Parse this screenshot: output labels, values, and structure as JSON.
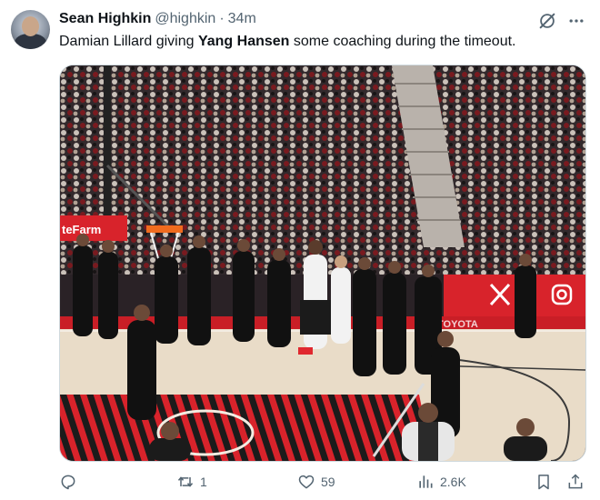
{
  "author": {
    "display_name": "Sean Highkin",
    "handle": "@highkin",
    "separator": "·",
    "time_ago": "34m"
  },
  "tweet": {
    "text_before": "Damian Lillard giving ",
    "text_bold": "Yang Hansen",
    "text_after": " some coaching during the timeout."
  },
  "media": {
    "sponsor_left": "teFarm",
    "baseline_sign": "TOYOTA",
    "social_icons": [
      "x-logo-icon",
      "instagram-icon"
    ]
  },
  "stats": {
    "replies": "",
    "reposts": "1",
    "likes": "59",
    "views": "2.6K"
  },
  "colors": {
    "text": "#0f1419",
    "muted": "#536471",
    "court_red": "#d8232b",
    "floor": "#e9dcc8"
  }
}
